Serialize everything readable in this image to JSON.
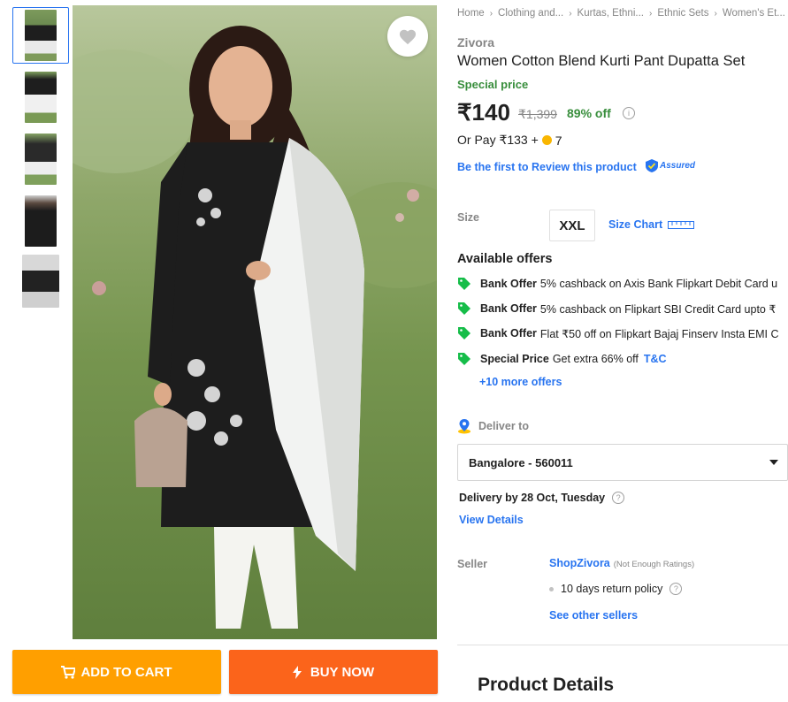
{
  "gallery": {
    "thumbnails": [
      {
        "name": "thumb-1",
        "active": true
      },
      {
        "name": "thumb-2",
        "active": false
      },
      {
        "name": "thumb-3",
        "active": false
      },
      {
        "name": "thumb-4",
        "active": false
      },
      {
        "name": "thumb-5",
        "active": false
      }
    ]
  },
  "actions": {
    "add_to_cart": "ADD TO CART",
    "buy_now": "BUY NOW",
    "cart_color": "#ff9f00",
    "buy_color": "#fb641b"
  },
  "breadcrumbs": [
    "Home",
    "Clothing and...",
    "Kurtas, Ethni...",
    "Ethnic Sets",
    "Women's Et..."
  ],
  "product": {
    "brand": "Zivora",
    "title": "Women Cotton Blend Kurti Pant Dupatta Set",
    "special": "Special price",
    "price": "₹140",
    "mrp": "₹1,399",
    "discount": "89% off",
    "or_pay": "Or Pay ₹133 +",
    "coins": "7",
    "review_link": "Be the first to Review this product",
    "assured": "Assured"
  },
  "size": {
    "label": "Size",
    "selected": "XXL",
    "chart": "Size Chart"
  },
  "offers": {
    "heading": "Available offers",
    "items": [
      {
        "type": "Bank Offer",
        "text": "5% cashback on Axis Bank Flipkart Debit Card u"
      },
      {
        "type": "Bank Offer",
        "text": "5% cashback on Flipkart SBI Credit Card upto ₹"
      },
      {
        "type": "Bank Offer",
        "text": "Flat ₹50 off on Flipkart Bajaj Finserv Insta EMI C"
      },
      {
        "type": "Special Price",
        "text": "Get extra 66% off",
        "link": "T&C"
      }
    ],
    "more": "+10 more offers"
  },
  "delivery": {
    "label": "Deliver to",
    "pincode": "Bangalore - 560011",
    "date": "Delivery by 28 Oct, Tuesday",
    "view_details": "View Details"
  },
  "seller": {
    "label": "Seller",
    "name": "ShopZivora",
    "rating_note": "(Not Enough Ratings)",
    "policy": "10 days return policy",
    "other": "See other sellers"
  },
  "section": {
    "product_details": "Product Details"
  }
}
